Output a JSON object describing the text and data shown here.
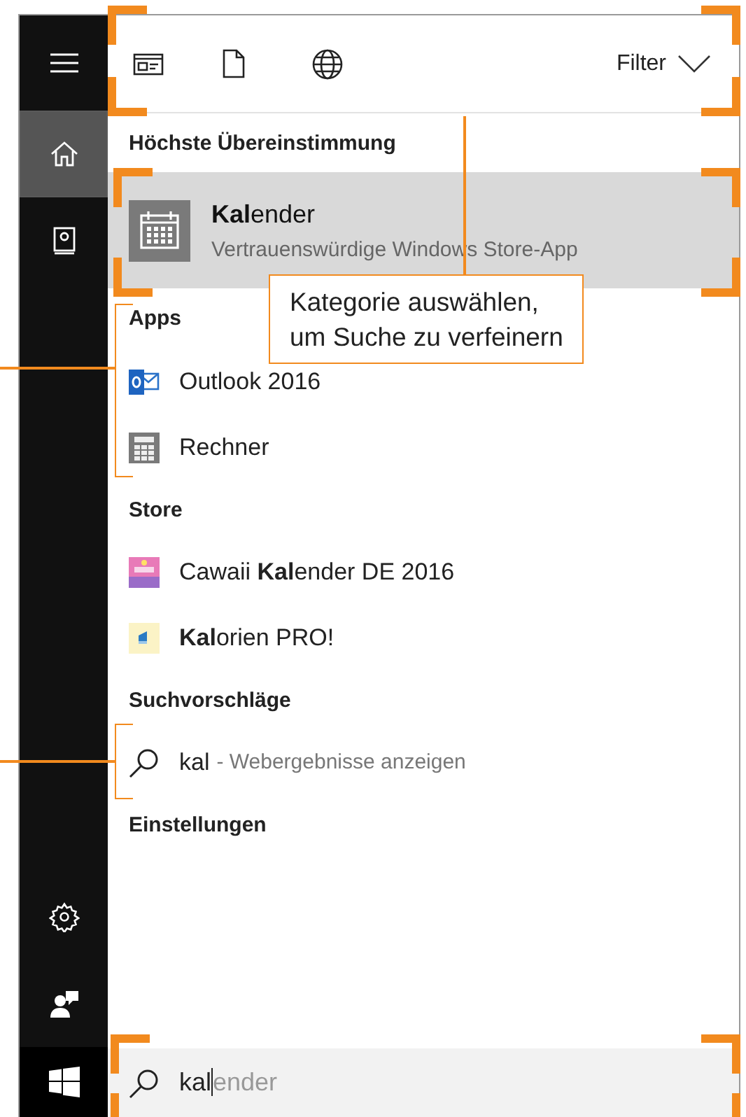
{
  "sidebar": {
    "items": [
      {
        "kind": "menu",
        "selected": false
      },
      {
        "kind": "home",
        "selected": true
      },
      {
        "kind": "notebook",
        "selected": false
      }
    ],
    "bottom_items": [
      {
        "kind": "settings",
        "selected": false
      },
      {
        "kind": "feedback",
        "selected": false
      },
      {
        "kind": "start",
        "selected": false
      }
    ]
  },
  "toolbar": {
    "filters": [
      {
        "kind": "apps"
      },
      {
        "kind": "documents"
      },
      {
        "kind": "web"
      }
    ],
    "filter_label": "Filter"
  },
  "best_match": {
    "heading": "Höchste Übereinstimmung",
    "title": "**Kal**ender",
    "subtitle": "Vertrauenswürdige Windows Store-App",
    "selected": true
  },
  "sections": [
    {
      "heading": "Apps",
      "items": [
        {
          "kind": "outlook",
          "label": "Outlook 2016"
        },
        {
          "kind": "calculator",
          "label": "Rechner"
        }
      ]
    },
    {
      "heading": "Store",
      "items": [
        {
          "kind": "cawaii",
          "label": "Cawaii **Kal**ender DE 2016"
        },
        {
          "kind": "kalorien",
          "label": "**Kal**orien PRO!"
        }
      ]
    },
    {
      "heading": "Suchvorschläge",
      "items": [
        {
          "kind": "suggestion",
          "label": "kal",
          "hint": "- Webergebnisse anzeigen"
        }
      ]
    },
    {
      "heading": "Einstellungen"
    }
  ],
  "search": {
    "value": "kal",
    "completion": "ender"
  },
  "callout": {
    "lines": [
      "Kategorie auswählen,",
      "um Suche zu verfeinern"
    ]
  }
}
